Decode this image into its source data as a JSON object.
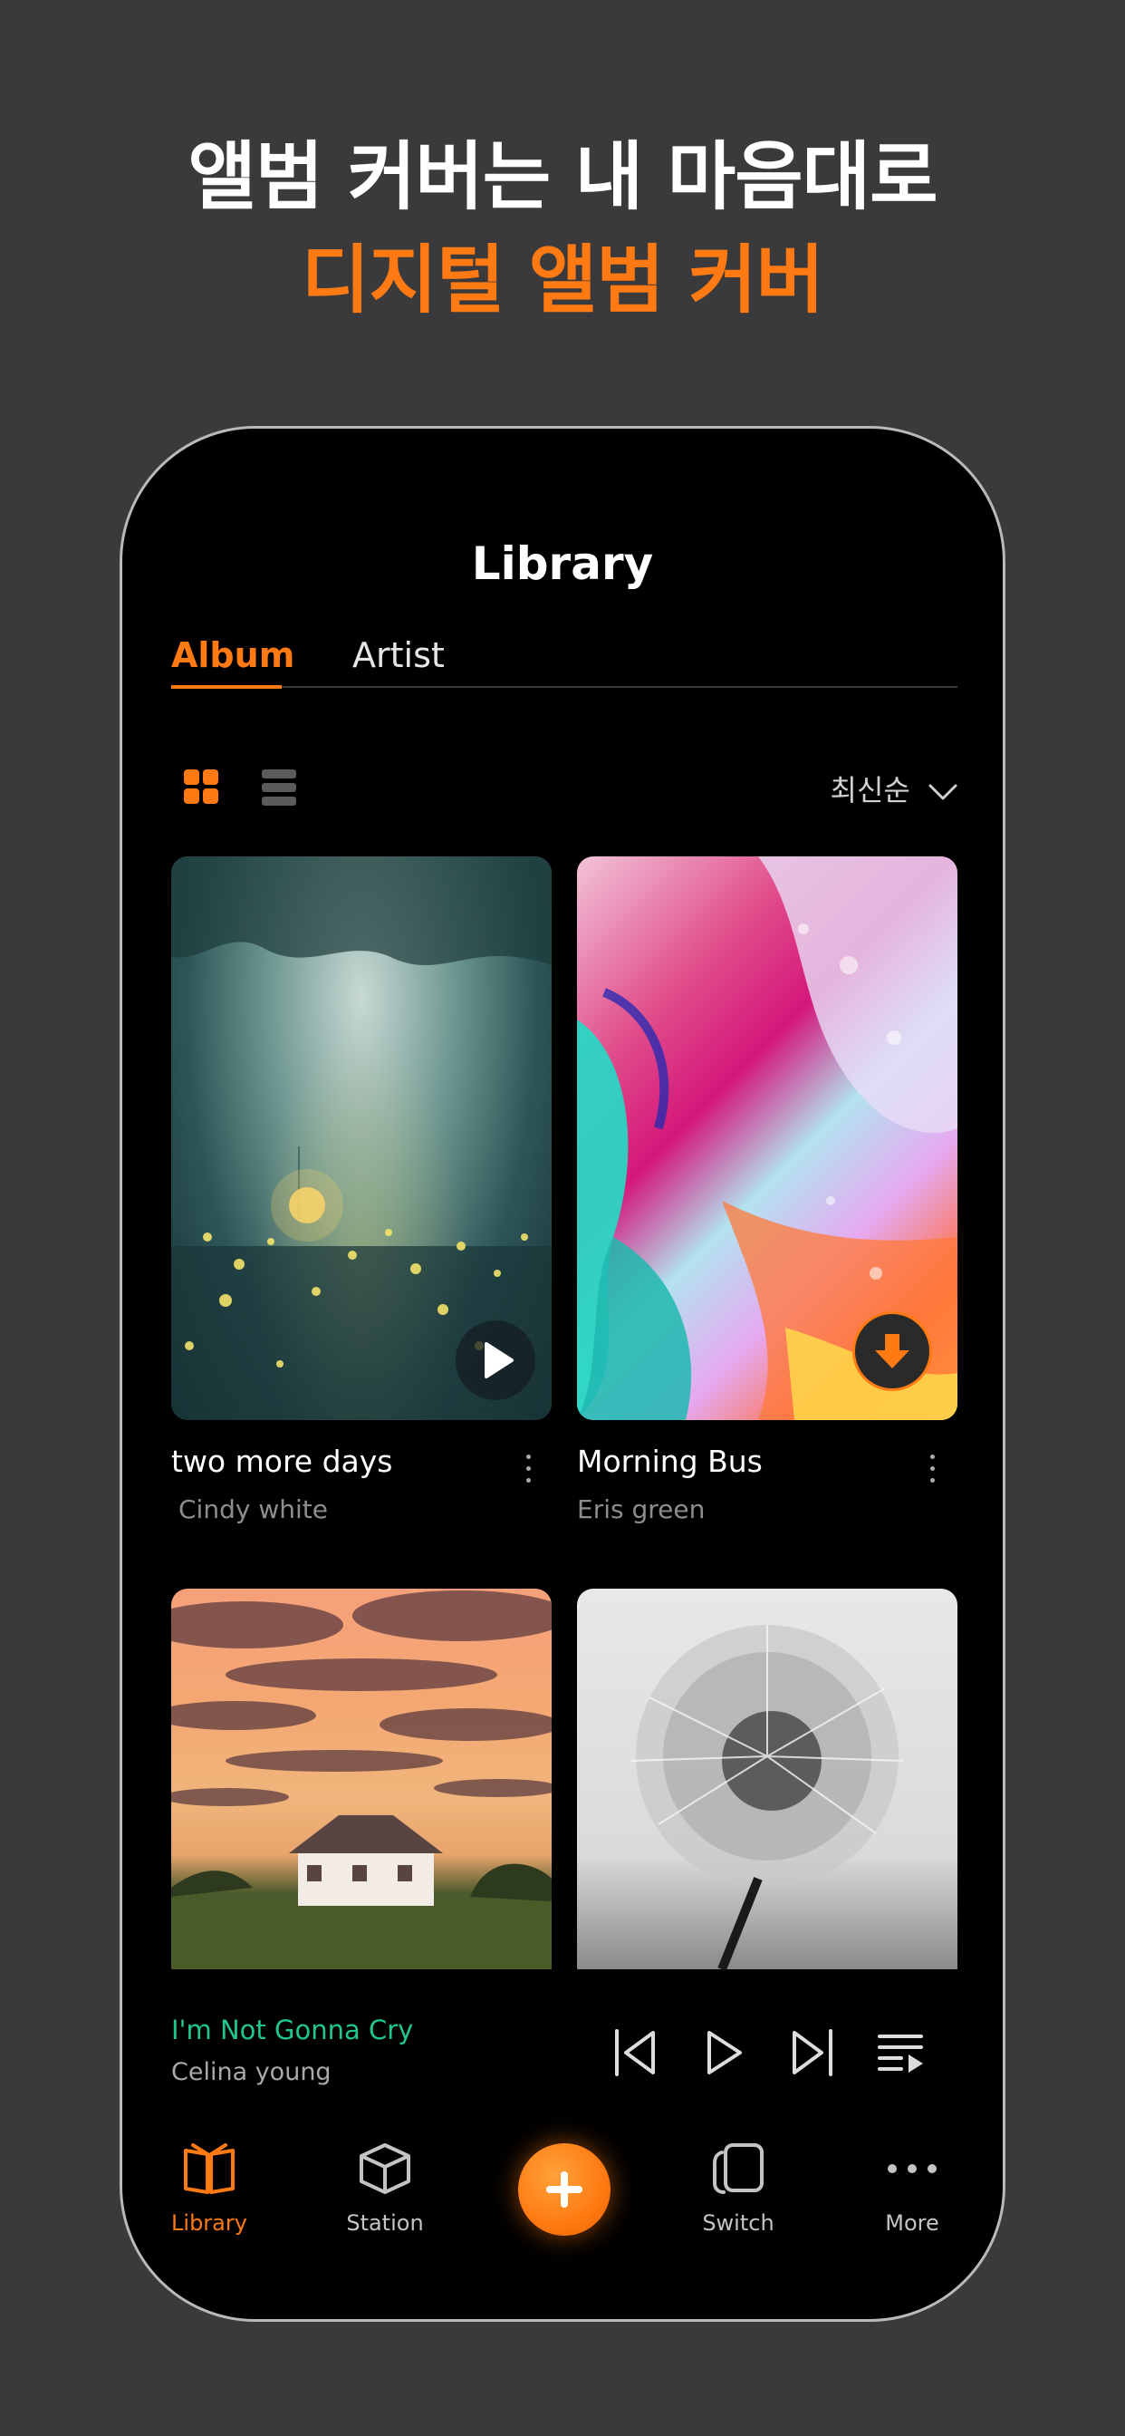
{
  "promo": {
    "line1": "앨범 커버는 내 마음대로",
    "line2": "디지털 앨범 커버"
  },
  "header": {
    "title": "Library"
  },
  "tabs": [
    {
      "label": "Album",
      "active": true
    },
    {
      "label": "Artist",
      "active": false
    }
  ],
  "view_toggle": {
    "grid_icon": "grid-icon",
    "list_icon": "list-icon",
    "active": "grid"
  },
  "sort": {
    "label": "최신순",
    "icon": "chevron-down-icon"
  },
  "albums": [
    {
      "title": "two more days",
      "artist": "Cindy white",
      "overlay": "play-icon"
    },
    {
      "title": "Morning Bus",
      "artist": "Eris green",
      "overlay": "download-icon"
    },
    {
      "title": "",
      "artist": ""
    },
    {
      "title": "",
      "artist": ""
    }
  ],
  "now_playing": {
    "title": "I'm Not Gonna Cry",
    "artist": "Celina young",
    "controls": [
      "previous-icon",
      "play-icon",
      "next-icon",
      "playlist-icon"
    ]
  },
  "nav": {
    "items": [
      {
        "label": "Library",
        "icon": "library-book-icon",
        "active": true
      },
      {
        "label": "Station",
        "icon": "cube-icon",
        "active": false
      },
      {
        "label": "Switch",
        "icon": "switch-cards-icon",
        "active": false
      },
      {
        "label": "More",
        "icon": "more-dots-icon",
        "active": false
      }
    ],
    "fab_icon": "plus-icon"
  },
  "colors": {
    "accent": "#ff7a12",
    "now_playing_title": "#21c78a",
    "background": "#3a3a3c",
    "phone": "#000000"
  }
}
